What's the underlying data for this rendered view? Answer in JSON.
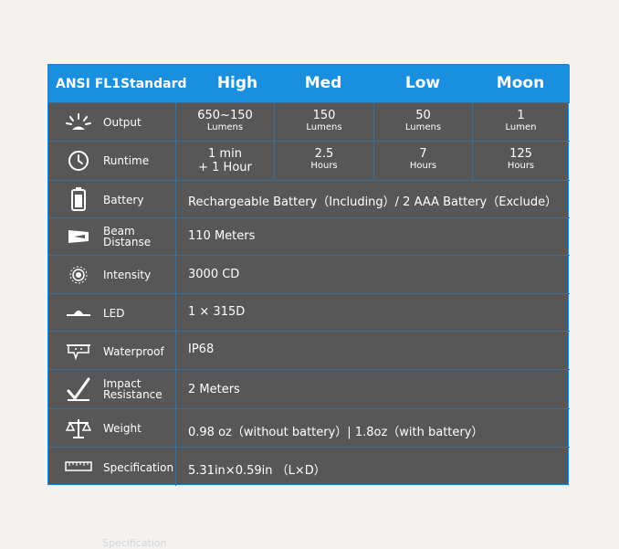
{
  "header": {
    "title": "ANSI FL1Standard",
    "modes": [
      "High",
      "Med",
      "Low",
      "Moon"
    ]
  },
  "rows": {
    "output": {
      "label": "Output",
      "cells": [
        {
          "main": "650~150",
          "unit": "Lumens"
        },
        {
          "main": "150",
          "unit": "Lumens"
        },
        {
          "main": "50",
          "unit": "Lumens"
        },
        {
          "main": "1",
          "unit": "Lumen"
        }
      ]
    },
    "runtime": {
      "label": "Runtime",
      "cells": [
        {
          "main": "1 min",
          "unit": "+ 1 Hour"
        },
        {
          "main": "2.5",
          "unit": "Hours"
        },
        {
          "main": "7",
          "unit": "Hours"
        },
        {
          "main": "125",
          "unit": "Hours"
        }
      ]
    },
    "battery": {
      "label": "Battery",
      "value": "Rechargeable Battery（Including）/  2 AAA Battery（Exclude）"
    },
    "beam": {
      "label_1": "Beam",
      "label_2": "Distanse",
      "value": "110 Meters"
    },
    "intensity": {
      "label": "Intensity",
      "value": "3000 CD"
    },
    "led": {
      "label": "LED",
      "value": "1 × 315D"
    },
    "waterproof": {
      "label": "Waterproof",
      "value": "IP68"
    },
    "impact": {
      "label_1": "Impact",
      "label_2": "Resistance",
      "value": "2 Meters"
    },
    "weight": {
      "label": "Weight",
      "value": "0.98 oz（without battery）|  1.8oz（with battery）"
    },
    "spec": {
      "label": "Specification",
      "value": "5.31in×0.59in （L×D）"
    }
  },
  "footer_ghost": "Specification",
  "colors": {
    "header_bg": "#1a8fe0",
    "body_bg": "#575757",
    "grid_line": "#3b6f98",
    "page_bg": "#f3f2f1"
  }
}
